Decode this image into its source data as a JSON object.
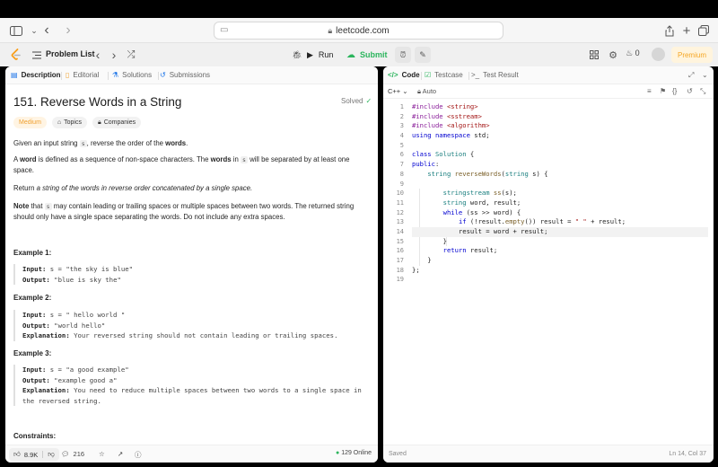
{
  "browser": {
    "url": "leetcode.com"
  },
  "header": {
    "problem_list_label": "Problem List",
    "run_label": "Run",
    "submit_label": "Submit",
    "fire_count": "0",
    "premium_label": "Premium"
  },
  "left_tabs": [
    "Description",
    "Editorial",
    "Solutions",
    "Submissions"
  ],
  "problem": {
    "title": "151. Reverse Words in a String",
    "status": "Solved",
    "difficulty": "Medium",
    "topics_label": "Topics",
    "companies_label": "Companies",
    "p1_pre": "Given an input string ",
    "p1_code": "s",
    "p1_mid": ", reverse the order of the ",
    "p1_bold": "words",
    "p1_end": ".",
    "p2_pre": "A ",
    "p2_bold1": "word",
    "p2_mid1": " is defined as a sequence of non-space characters. The ",
    "p2_bold2": "words",
    "p2_mid2": " in ",
    "p2_code": "s",
    "p2_end": " will be separated by at least one space.",
    "p3_pre": "Return ",
    "p3_italic": "a string of the words in reverse order concatenated by a single space.",
    "p4_bold": "Note",
    "p4_mid": " that ",
    "p4_code": "s",
    "p4_end": " may contain leading or trailing spaces or multiple spaces between two words. The returned string should only have a single space separating the words. Do not include any extra spaces.",
    "ex1_title": "Example 1:",
    "ex1_input": "s = \"the sky is blue\"",
    "ex1_output": "\"blue is sky the\"",
    "ex2_title": "Example 2:",
    "ex2_input": "s = \"  hello world  \"",
    "ex2_output": "\"world hello\"",
    "ex2_expl": "Your reversed string should not contain leading or trailing spaces.",
    "ex3_title": "Example 3:",
    "ex3_input": "s = \"a good   example\"",
    "ex3_output": "\"example good a\"",
    "ex3_expl": "You need to reduce multiple spaces between two words to a single space in the reversed string.",
    "input_label": "Input:",
    "output_label": "Output:",
    "expl_label": "Explanation:",
    "constraints_title": "Constraints:"
  },
  "left_footer": {
    "likes": "8.9K",
    "comments": "216",
    "online": "129 Online"
  },
  "right_tabs": [
    "Code",
    "Testcase",
    "Test Result"
  ],
  "editor": {
    "language": "C++",
    "mode": "Auto",
    "saved_label": "Saved",
    "cursor_pos": "Ln 14, Col 37"
  }
}
